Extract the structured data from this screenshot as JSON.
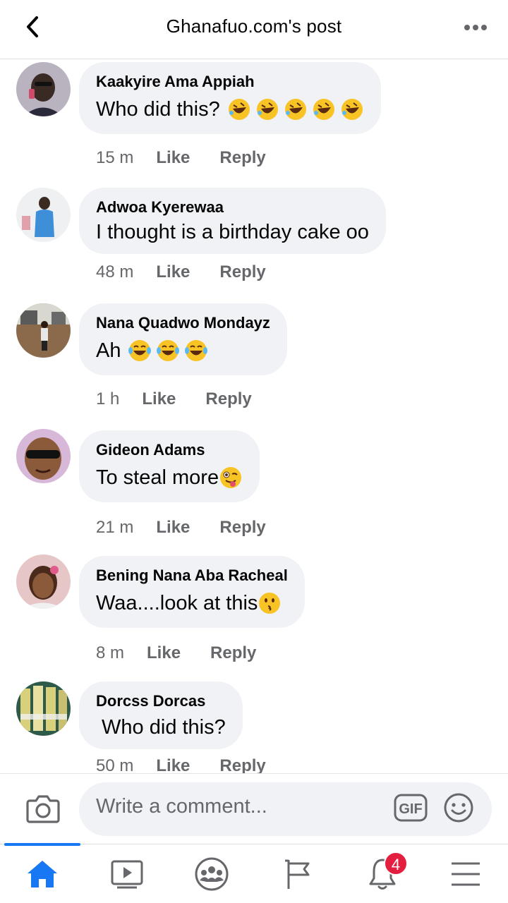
{
  "header": {
    "title": "Ghanafuo.com's post",
    "back_icon": "chevron-left-icon",
    "more_icon": "more-horizontal-icon"
  },
  "comments": [
    {
      "author": "Kaakyire Ama Appiah",
      "text": "Who did this?",
      "emoji": [
        "rolling-on-floor-laughing",
        "rolling-on-floor-laughing",
        "rolling-on-floor-laughing",
        "rolling-on-floor-laughing",
        "rolling-on-floor-laughing"
      ],
      "time": "15 m",
      "like_label": "Like",
      "reply_label": "Reply"
    },
    {
      "author": "Adwoa Kyerewaa",
      "text": "I thought is a birthday cake oo",
      "emoji": [],
      "time": "48 m",
      "like_label": "Like",
      "reply_label": "Reply"
    },
    {
      "author": "Nana Quadwo Mondayz",
      "text": "Ah",
      "emoji": [
        "tears-of-joy",
        "tears-of-joy",
        "tears-of-joy"
      ],
      "time": "1 h",
      "like_label": "Like",
      "reply_label": "Reply"
    },
    {
      "author": "Gideon Adams",
      "text": "To steal more",
      "emoji": [
        "winking-tongue"
      ],
      "time": "21 m",
      "like_label": "Like",
      "reply_label": "Reply"
    },
    {
      "author": "Bening Nana Aba Racheal",
      "text": "Waa....look at this",
      "emoji": [
        "kissing-face"
      ],
      "time": "8 m",
      "like_label": "Like",
      "reply_label": "Reply"
    },
    {
      "author": "Dorcss Dorcas",
      "text": " Who did this?",
      "emoji": [],
      "time": "50 m",
      "like_label": "Like",
      "reply_label": "Reply"
    }
  ],
  "composer": {
    "placeholder": "Write a comment...",
    "gif_label": "GIF",
    "camera_icon": "camera-icon",
    "emoji_icon": "smiley-icon"
  },
  "nav": {
    "items": [
      "home-icon",
      "watch-icon",
      "groups-icon",
      "pages-icon",
      "notifications-icon",
      "menu-icon"
    ],
    "active": "home",
    "notifications_badge": "4",
    "accent": "#1877f2",
    "badge_color": "#e41e3f"
  }
}
